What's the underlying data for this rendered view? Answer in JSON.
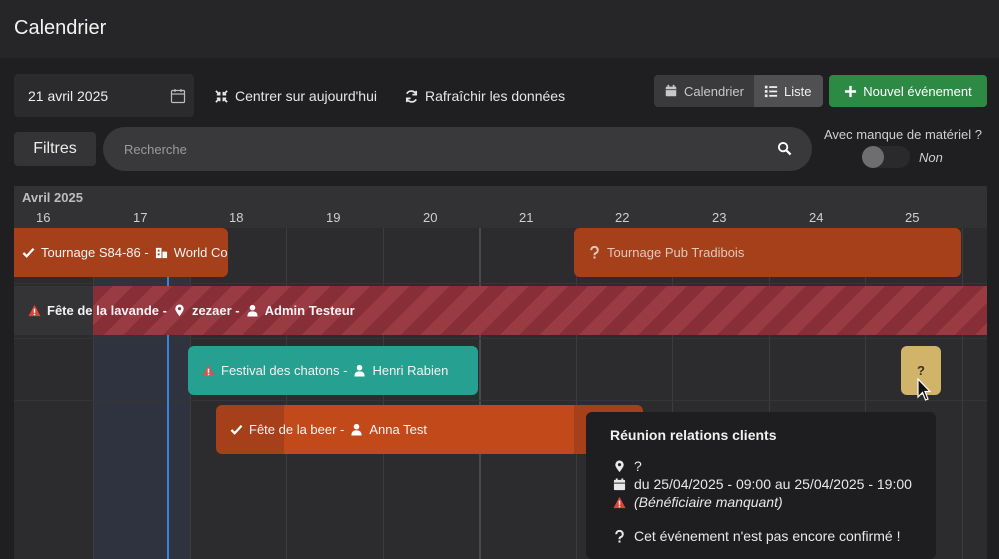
{
  "header": {
    "title": "Calendrier"
  },
  "toolbar": {
    "date_value": "21 avril 2025",
    "center_today": "Centrer sur aujourd'hui",
    "refresh": "Rafraîchir les données",
    "view_calendar": "Calendrier",
    "view_list": "Liste",
    "new_event": "Nouvel événement"
  },
  "filters": {
    "filters_label": "Filtres",
    "search_placeholder": "Recherche",
    "missing_material_label": "Avec manque de matériel ?",
    "missing_material_value": "Non",
    "missing_material_on": false
  },
  "timeline": {
    "month": "Avril 2025",
    "days": [
      "16",
      "17",
      "18",
      "19",
      "20",
      "21",
      "22",
      "23",
      "24",
      "25"
    ]
  },
  "events": [
    {
      "label": "Tournage S84-86 -",
      "extra": "World Co",
      "status": "confirmed",
      "color": "#a5401a"
    },
    {
      "label": "Tournage Pub Tradibois",
      "status": "unconfirmed",
      "color": "#a5401a"
    },
    {
      "label": "Fête de la lavande -",
      "location": "zezaer -",
      "person": "Admin Testeur",
      "status": "warning",
      "color": "#882e37"
    },
    {
      "label": "Festival des chatons -",
      "person": "Henri Rabien",
      "status": "warning",
      "color": "#26a090"
    },
    {
      "label": "Fête de la beer -",
      "person": "Anna Test",
      "status": "confirmed",
      "color": "#a5401a"
    },
    {
      "label": "?",
      "status": "unconfirmed",
      "color": "#d2b36a"
    }
  ],
  "tooltip": {
    "title": "Réunion relations clients",
    "location": "?",
    "dates": "du 25/04/2025 - 09:00 au 25/04/2025 - 19:00",
    "warning": "(Bénéficiaire manquant)",
    "unconfirmed": "Cet événement n'est pas encore confirmé !"
  },
  "colors": {
    "accent_green": "#2d8a45",
    "today_line": "#3d82d9",
    "warning_red": "#e0423a"
  }
}
